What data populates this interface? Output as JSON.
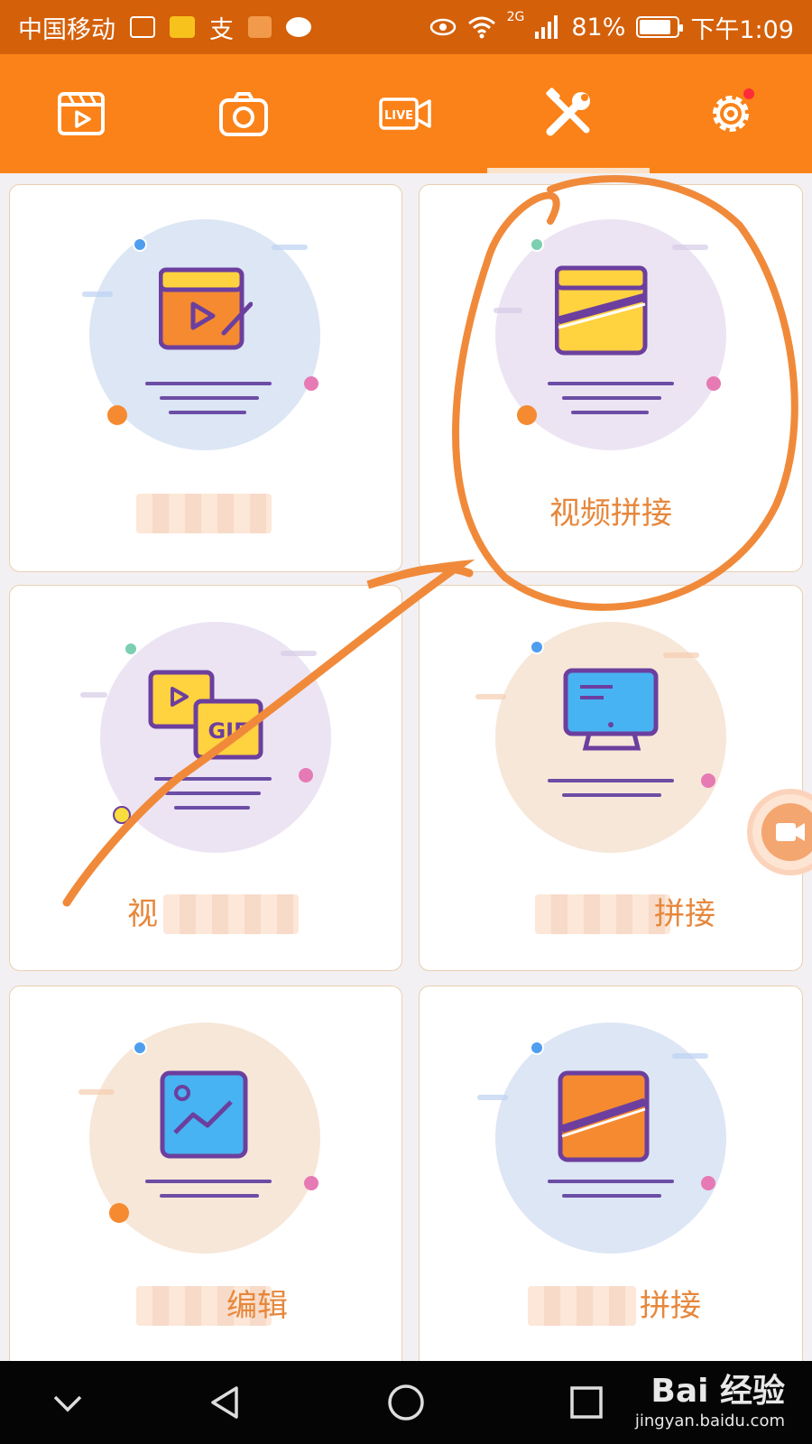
{
  "status_bar": {
    "carrier": "中国移动",
    "network": "2G",
    "battery": "81%",
    "time": "下午1:09",
    "pay_glyph": "支"
  },
  "toolbar": {
    "tabs": [
      {
        "icon": "video-clapper-icon"
      },
      {
        "icon": "camera-icon"
      },
      {
        "icon": "live-camera-icon",
        "text": "LIVE"
      },
      {
        "icon": "tools-icon"
      },
      {
        "icon": "gear-icon"
      }
    ],
    "active_index": 3,
    "accent": "#fb8218"
  },
  "cards": [
    {
      "label": "",
      "circle_color": "#dce6f5",
      "icon": "video-edit-icon"
    },
    {
      "label": "视频拼接",
      "circle_color": "#ece4f3",
      "icon": "video-merge-icon"
    },
    {
      "label": "视",
      "circle_color": "#ece4f3",
      "icon": "gif-icon",
      "gif_text": "GIF"
    },
    {
      "label": "拼接",
      "circle_color": "#f7e7d8",
      "icon": "screen-record-icon"
    },
    {
      "label": "编辑",
      "circle_color": "#f7e7d8",
      "icon": "image-edit-icon"
    },
    {
      "label": "拼接",
      "circle_color": "#dde6f5",
      "icon": "image-merge-icon"
    }
  ],
  "watermark": {
    "brand": "Bai 经验",
    "url": "jingyan.baidu.com"
  },
  "colors": {
    "status_bg": "#d4600a",
    "label": "#e6873c",
    "annotation": "#f08a3a"
  }
}
